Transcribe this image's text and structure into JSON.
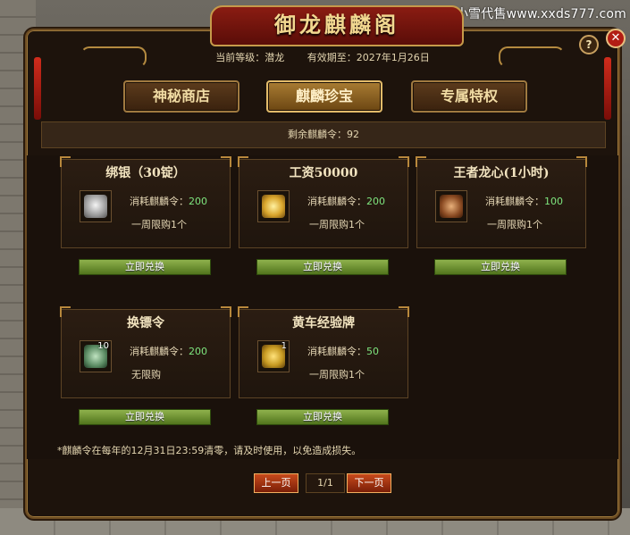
{
  "watermark": "小雪代售www.xxds777.com",
  "window": {
    "title": "御龙麒麟阁",
    "help": "?",
    "close": "✕"
  },
  "info": {
    "level_label": "当前等级：潜龙",
    "expiry_label": "有效期至：2027年1月26日"
  },
  "tabs": [
    {
      "label": "神秘商店",
      "active": false
    },
    {
      "label": "麒麟珍宝",
      "active": true
    },
    {
      "label": "专属特权",
      "active": false
    }
  ],
  "remaining": "剩余麒麟令：92",
  "items": [
    {
      "name": "绑银（30锭）",
      "cost_label": "消耗麒麟令：",
      "cost": "200",
      "limit": "一周限购1个",
      "icon": "silver-ingot-icon",
      "stack": "",
      "button": "立即兑换"
    },
    {
      "name": "工资50000",
      "cost_label": "消耗麒麟令：",
      "cost": "200",
      "limit": "一周限购1个",
      "icon": "gold-treasure-icon",
      "stack": "",
      "button": "立即兑换"
    },
    {
      "name": "王者龙心(1小时)",
      "cost_label": "消耗麒麟令：",
      "cost": "100",
      "limit": "一周限购1个",
      "icon": "dragon-heart-icon",
      "stack": "",
      "button": "立即兑换"
    },
    {
      "name": "换镖令",
      "cost_label": "消耗麒麟令：",
      "cost": "200",
      "limit": "无限购",
      "icon": "token-icon",
      "stack": "10",
      "button": "立即兑换"
    },
    {
      "name": "黄车经验牌",
      "cost_label": "消耗麒麟令：",
      "cost": "50",
      "limit": "一周限购1个",
      "icon": "yellow-cart-icon",
      "stack": "1",
      "button": "立即兑换"
    }
  ],
  "note": "*麒麟令在每年的12月31日23:59清零，请及时使用，以免造成损失。",
  "pager": {
    "prev": "上一页",
    "current": "1/1",
    "next": "下一页"
  },
  "colors": {
    "cost_green": "#7ee57e",
    "exchange_button": "#6f9630",
    "active_tab": "#a97c33"
  }
}
